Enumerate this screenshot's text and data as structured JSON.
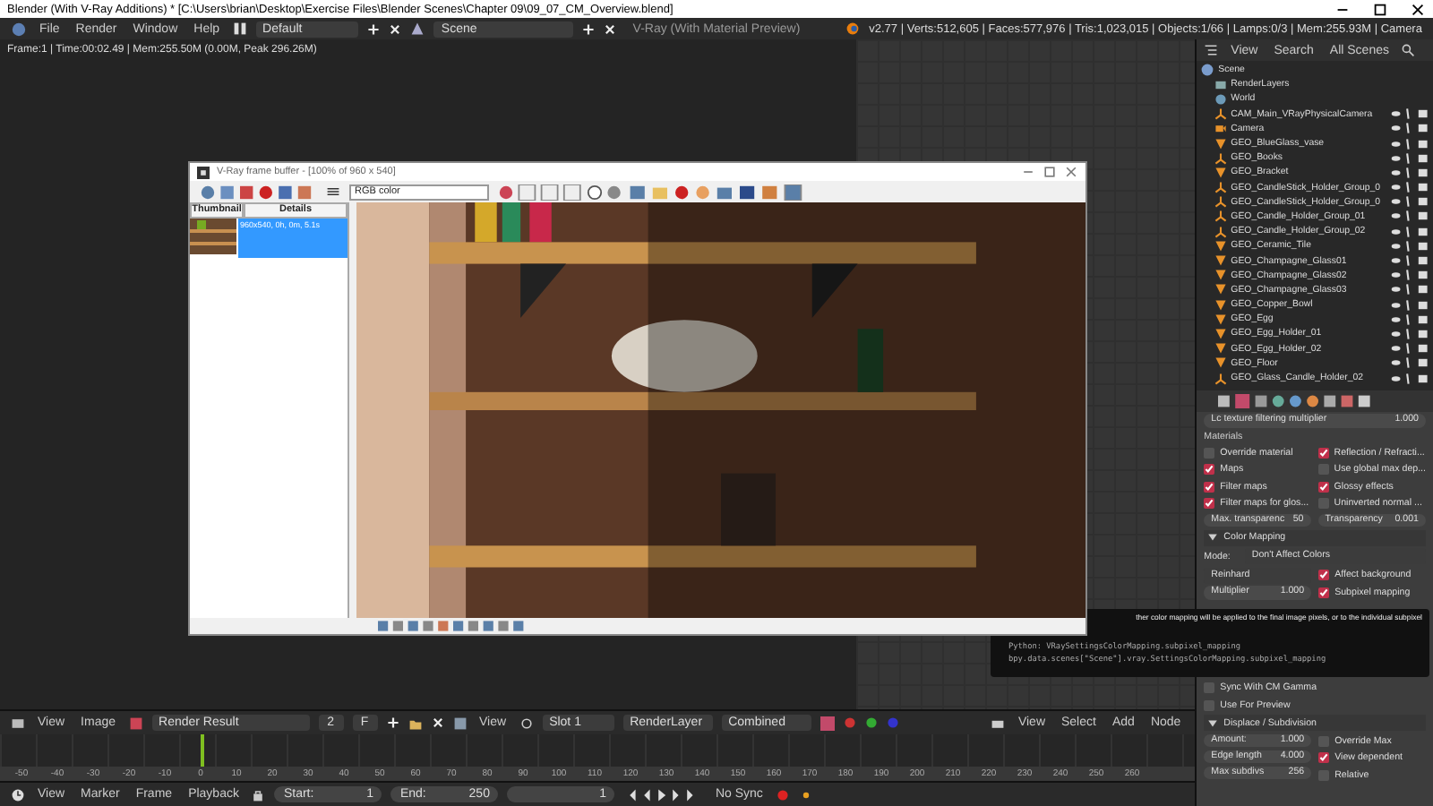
{
  "window": {
    "title": "Blender (With V-Ray Additions) * [C:\\Users\\brian\\Desktop\\Exercise Files\\Blender Scenes\\Chapter 09\\09_07_CM_Overview.blend]"
  },
  "menu": [
    "File",
    "Render",
    "Window",
    "Help"
  ],
  "layout": "Default",
  "scene": "Scene",
  "engine": "V-Ray (With Material Preview)",
  "stats": "v2.77 | Verts:512,605 | Faces:577,976 | Tris:1,023,015 | Objects:1/66 | Lamps:0/3 | Mem:255.93M | Camera",
  "image_info": "Frame:1 | Time:00:02.49 | Mem:255.50M (0.00M, Peak 296.26M)",
  "frame_buffer": {
    "title": "V-Ray frame buffer - [100% of 960 x 540]",
    "channel": "RGB color",
    "columns": [
      "Thumbnail",
      "Details"
    ],
    "history": [
      {
        "details": "960x540, 0h, 0m, 5.1s",
        "selected": true
      }
    ]
  },
  "outliner": {
    "menu": [
      "View",
      "Search"
    ],
    "filter": "All Scenes",
    "tree": [
      {
        "name": "Scene",
        "kind": "scene",
        "children": [
          {
            "name": "RenderLayers",
            "kind": "render"
          },
          {
            "name": "World",
            "kind": "world"
          },
          {
            "name": "CAM_Main_VRayPhysicalCamera",
            "kind": "empty"
          },
          {
            "name": "Camera",
            "kind": "camera"
          },
          {
            "name": "GEO_BlueGlass_vase",
            "kind": "mesh"
          },
          {
            "name": "GEO_Books",
            "kind": "empty"
          },
          {
            "name": "GEO_Bracket",
            "kind": "mesh"
          },
          {
            "name": "GEO_CandleStick_Holder_Group_0",
            "kind": "empty"
          },
          {
            "name": "GEO_CandleStick_Holder_Group_0",
            "kind": "empty"
          },
          {
            "name": "GEO_Candle_Holder_Group_01",
            "kind": "empty"
          },
          {
            "name": "GEO_Candle_Holder_Group_02",
            "kind": "empty"
          },
          {
            "name": "GEO_Ceramic_Tile",
            "kind": "mesh"
          },
          {
            "name": "GEO_Champagne_Glass01",
            "kind": "mesh"
          },
          {
            "name": "GEO_Champagne_Glass02",
            "kind": "mesh"
          },
          {
            "name": "GEO_Champagne_Glass03",
            "kind": "mesh"
          },
          {
            "name": "GEO_Copper_Bowl",
            "kind": "mesh"
          },
          {
            "name": "GEO_Egg",
            "kind": "mesh"
          },
          {
            "name": "GEO_Egg_Holder_01",
            "kind": "mesh"
          },
          {
            "name": "GEO_Egg_Holder_02",
            "kind": "mesh"
          },
          {
            "name": "GEO_Floor",
            "kind": "mesh"
          },
          {
            "name": "GEO_Glass_Candle_Holder_02",
            "kind": "empty"
          }
        ]
      }
    ]
  },
  "properties": {
    "cut_row": {
      "label": "Lc texture filtering multiplier",
      "value": "1.000"
    },
    "materials": {
      "title": "Materials",
      "options": [
        {
          "label": "Override material",
          "checked": false
        },
        {
          "label": "Reflection / Refracti...",
          "checked": true
        },
        {
          "label": "Maps",
          "checked": true
        },
        {
          "label": "Use global max dep...",
          "checked": false
        },
        {
          "label": "Filter maps",
          "checked": true
        },
        {
          "label": "Glossy effects",
          "checked": true
        },
        {
          "label": "Filter maps for glos...",
          "checked": true
        },
        {
          "label": "Uninverted normal ...",
          "checked": false
        }
      ],
      "fields": [
        {
          "label": "Max. transparenc",
          "value": "50"
        },
        {
          "label": "Transparency",
          "value": "0.001"
        }
      ]
    },
    "color_mapping": {
      "title": "Color Mapping",
      "expanded": true,
      "mode_label": "Mode:",
      "mode": "Don't Affect Colors",
      "type": "Reinhard",
      "multiplier": {
        "label": "Multiplier",
        "value": "1.000"
      },
      "options": [
        {
          "label": "Affect background",
          "checked": true
        },
        {
          "label": "Subpixel mapping",
          "checked": true
        }
      ],
      "more_options": [
        {
          "label": "Sync With CM Gamma",
          "checked": false
        },
        {
          "label": "Use For Preview",
          "checked": false
        }
      ]
    },
    "displace": {
      "title": "Displace / Subdivision",
      "expanded": true,
      "fields": [
        {
          "label": "Amount:",
          "value": "1.000"
        },
        {
          "label": "Edge length",
          "value": "4.000"
        },
        {
          "label": "Max subdivs",
          "value": "256"
        }
      ],
      "options": [
        {
          "label": "Override Max",
          "checked": false
        },
        {
          "label": "View dependent",
          "checked": true
        },
        {
          "label": "Relative",
          "checked": false
        }
      ]
    }
  },
  "tooltip": {
    "text": "ther color mapping will be applied to the final image pixels, or to the individual subpixel",
    "python": "Python: VRaySettingsColorMapping.subpixel_mapping",
    "path": "bpy.data.scenes[\"Scene\"].vray.SettingsColorMapping.subpixel_mapping"
  },
  "image_editor": {
    "menu": [
      "View",
      "Image"
    ],
    "image": "Render Result",
    "users": "2",
    "fake": "F",
    "view": "View",
    "slot": "Slot 1",
    "layer": "RenderLayer",
    "pass": "Combined"
  },
  "node_editor": {
    "menu": [
      "View",
      "Select",
      "Add",
      "Node"
    ]
  },
  "timeline": {
    "ticks": [
      "-50",
      "-40",
      "-30",
      "-20",
      "-10",
      "0",
      "10",
      "20",
      "30",
      "40",
      "50",
      "60",
      "70",
      "80",
      "90",
      "100",
      "110",
      "120",
      "130",
      "140",
      "150",
      "160",
      "170",
      "180",
      "190",
      "200",
      "210",
      "220",
      "230",
      "240",
      "250",
      "260"
    ],
    "menu": [
      "View",
      "Marker",
      "Frame",
      "Playback"
    ],
    "start": {
      "label": "Start:",
      "value": "1"
    },
    "end": {
      "label": "End:",
      "value": "250"
    },
    "current": "1",
    "sync": "No Sync"
  }
}
